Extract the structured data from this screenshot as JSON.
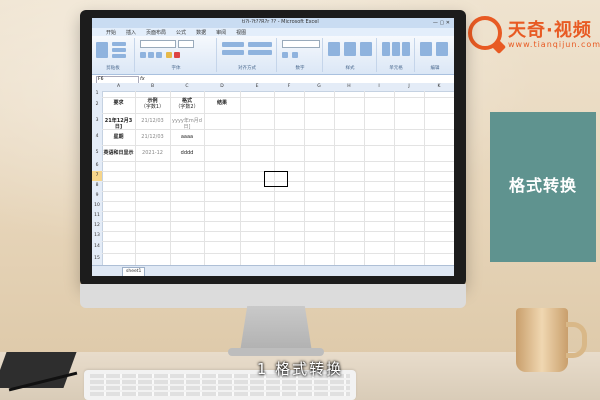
{
  "brand": {
    "name": "天奇·视频",
    "url": "www.tianqijun.com"
  },
  "side_card": {
    "label": "格式转换"
  },
  "subtitle": "1 格式转换",
  "excel": {
    "title": "ti?i-?t??R?r ?? - Microsoft Excel",
    "menu": [
      "开始",
      "插入",
      "页面布局",
      "公式",
      "数据",
      "审阅",
      "视图"
    ],
    "ribbon_groups": [
      "剪贴板",
      "字体",
      "对齐方式",
      "数字",
      "样式",
      "单元格",
      "编辑"
    ],
    "namebox": "F6",
    "fx": "fx",
    "columns": [
      "A",
      "B",
      "C",
      "D",
      "E",
      "F",
      "G",
      "H",
      "I",
      "J",
      "K"
    ],
    "rows": [
      "1",
      "2",
      "3",
      "4",
      "5",
      "6",
      "7",
      "8",
      "9",
      "10",
      "11",
      "12",
      "13",
      "14",
      "15"
    ],
    "headers": [
      "要求",
      "示例\n（字数1）",
      "格式\n（字数2）",
      "结果"
    ],
    "header_col1": "要求",
    "header_col2a": "示例",
    "header_col2b": "（字数1）",
    "header_col3a": "格式",
    "header_col3b": "（字数2）",
    "header_col4": "结果",
    "rows_data": [
      {
        "req": "21年12月3日]",
        "ex": "21/12/03",
        "fmt": "yyyy年m月d日]"
      },
      {
        "req": "星期",
        "ex": "21/12/03",
        "fmt": "aaaa"
      },
      {
        "req": "英语和日显示",
        "ex": "2021-12",
        "fmt": "dddd"
      }
    ],
    "sheet_tab": "sheet1"
  }
}
